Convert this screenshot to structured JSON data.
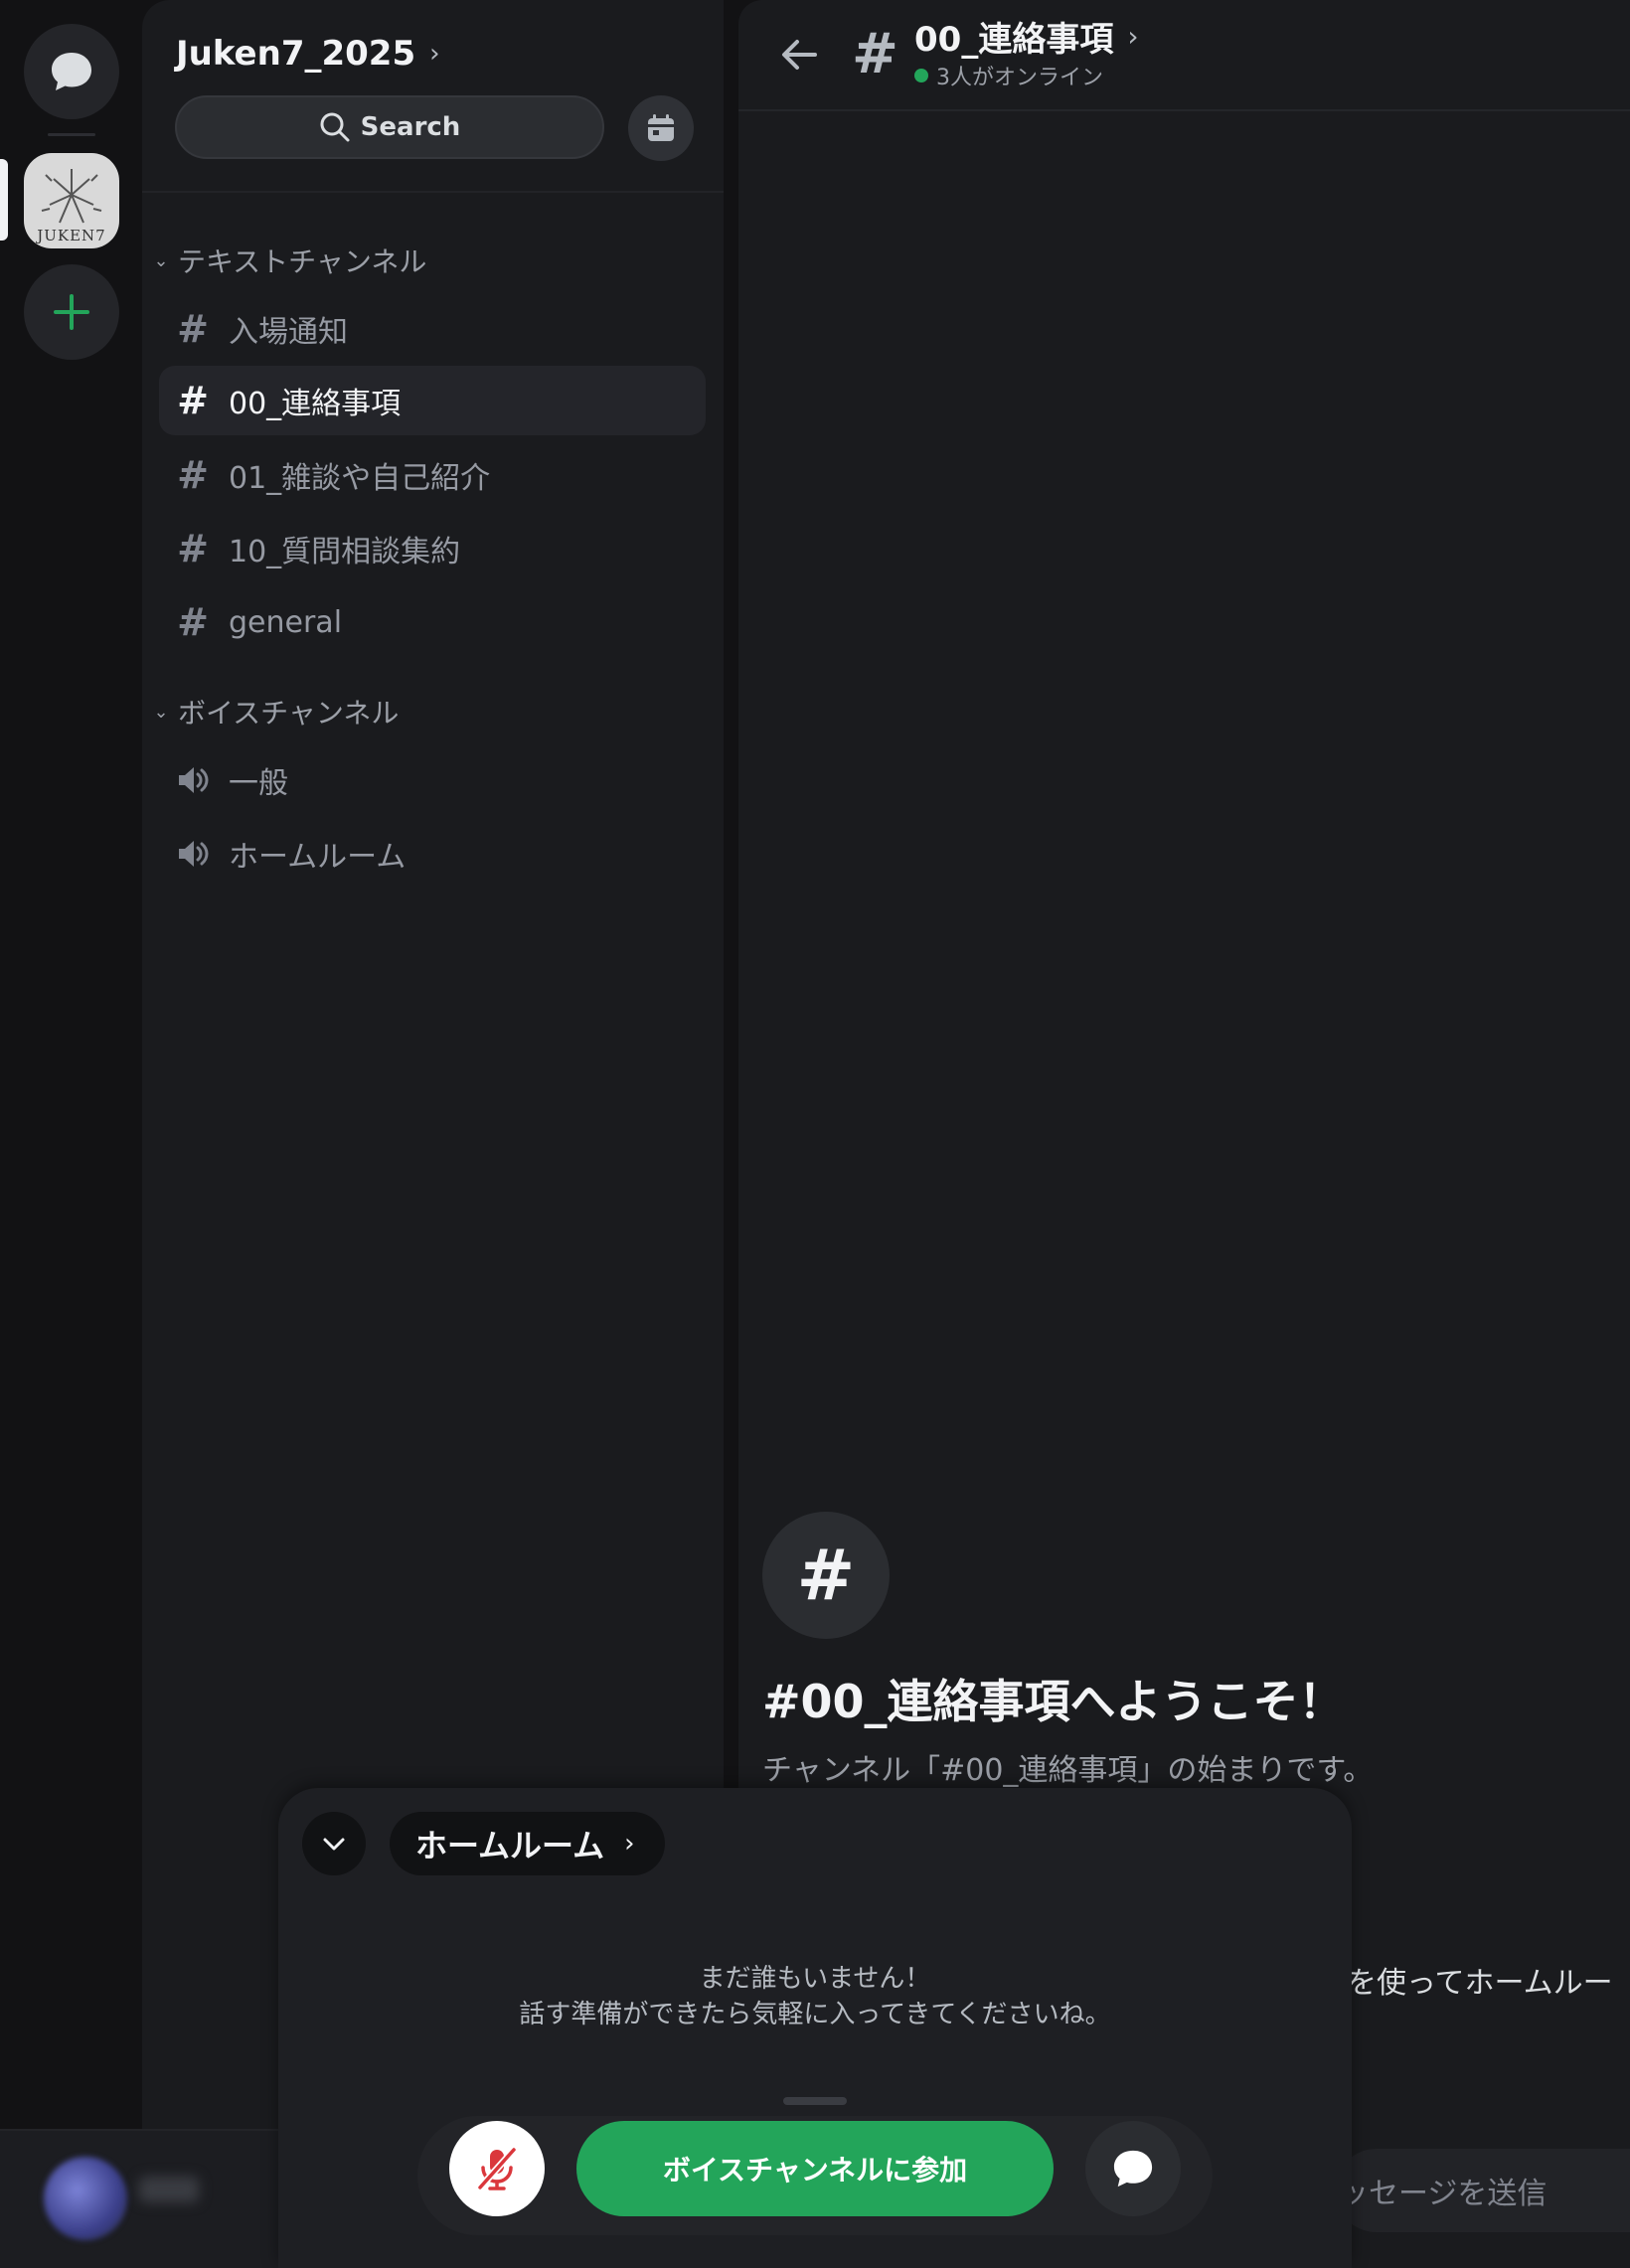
{
  "server": {
    "name": "Juken7_2025",
    "icon_text": "JUKEN7",
    "search_label": "Search"
  },
  "categories": {
    "text": "テキストチャンネル",
    "voice": "ボイスチャンネル"
  },
  "text_channels": [
    {
      "name": "入場通知",
      "active": false
    },
    {
      "name": "00_連絡事項",
      "active": true
    },
    {
      "name": "01_雑談や自己紹介",
      "active": false
    },
    {
      "name": "10_質問相談集約",
      "active": false
    },
    {
      "name": "general",
      "active": false
    }
  ],
  "voice_channels": [
    {
      "name": "一般"
    },
    {
      "name": "ホームルーム"
    }
  ],
  "header": {
    "channel": "00_連絡事項",
    "status": "3人がオンライン",
    "status_color": "#23a55a"
  },
  "welcome": {
    "title": "#00_連絡事項へようこそ！",
    "subtitle": "チャンネル「#00_連絡事項」の始まりです。",
    "hint_fragment": "を使ってホームルー",
    "input_placeholder": "ッセージを送信"
  },
  "voice_sheet": {
    "channel_name": "ホームルーム",
    "empty_line1": "まだ誰もいません！",
    "empty_line2": "話す準備ができたら気軽に入ってきてくださいね。",
    "join_label": "ボイスチャンネルに参加",
    "join_color": "#23a55a"
  },
  "icons": {
    "dm": "chat-bubble-icon",
    "add": "plus-icon",
    "search": "search-icon",
    "events": "calendar-icon",
    "back": "arrow-left-icon",
    "mute": "mic-off-icon",
    "chat": "chat-bubble-icon"
  }
}
